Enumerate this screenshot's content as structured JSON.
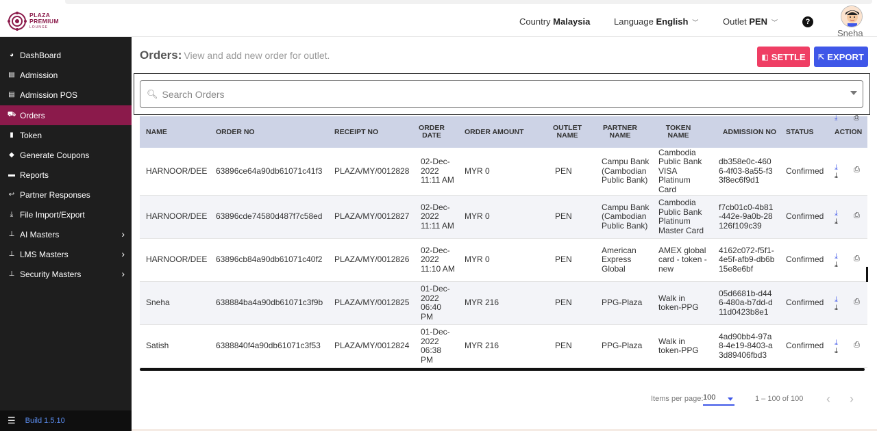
{
  "header": {
    "logo_line1": "PLAZA",
    "logo_line2": "PREMIUM",
    "logo_line3": "LOUNGE",
    "country_label": "Country",
    "country_value": "Malaysia",
    "language_label": "Language",
    "language_value": "English",
    "outlet_label": "Outlet",
    "outlet_value": "PEN",
    "help_glyph": "?",
    "user_name": "Sneha"
  },
  "sidebar": {
    "items": [
      {
        "label": "DashBoard",
        "icon": "dashboard-icon",
        "glyph": "◕"
      },
      {
        "label": "Admission",
        "icon": "id-card-icon",
        "glyph": "▤"
      },
      {
        "label": "Admission POS",
        "icon": "id-card-icon",
        "glyph": "▤"
      },
      {
        "label": "Orders",
        "icon": "cart-icon",
        "glyph": "🛒"
      },
      {
        "label": "Token",
        "icon": "document-icon",
        "glyph": "▮"
      },
      {
        "label": "Generate Coupons",
        "icon": "tag-icon",
        "glyph": "◆"
      },
      {
        "label": "Reports",
        "icon": "book-icon",
        "glyph": "▬"
      },
      {
        "label": "Partner Responses",
        "icon": "reply-icon",
        "glyph": "↩"
      },
      {
        "label": "File Import/Export",
        "icon": "download-icon",
        "glyph": "⤓"
      },
      {
        "label": "AI Masters",
        "icon": "sitemap-icon",
        "glyph": "⊥"
      },
      {
        "label": "LMS Masters",
        "icon": "sitemap-icon",
        "glyph": "⊥"
      },
      {
        "label": "Security Masters",
        "icon": "sitemap-icon",
        "glyph": "⊥"
      }
    ],
    "build": "Build 1.5.10"
  },
  "main": {
    "title": "Orders:",
    "subtitle": "View and add new order for outlet.",
    "settle_label": "SETTLE",
    "export_label": "EXPORT",
    "search_placeholder": "Search Orders"
  },
  "table": {
    "columns": [
      "NAME",
      "ORDER NO",
      "RECEIPT NO",
      "ORDER DATE",
      "ORDER AMOUNT",
      "OUTLET NAME",
      "PARTNER NAME",
      "TOKEN NAME",
      "ADMISSION NO",
      "STATUS",
      "ACTION"
    ],
    "rows": [
      {
        "name": "HARNOOR/DEE",
        "order_no": "63896ce64a90db61071c41f3",
        "receipt_no": "PLAZA/MY/0012828",
        "order_date": "02-Dec-2022 11:11 AM",
        "amount": "MYR 0",
        "outlet": "PEN",
        "partner": "Campu Bank (Cambodian Public Bank)",
        "token": "Cambodia Public Bank VISA Platinum Card",
        "admission_no": "db358e0c-4606-4f03-8a55-f33f8ec6f9d1",
        "status": "Confirmed"
      },
      {
        "name": "HARNOOR/DEE",
        "order_no": "63896cde74580d487f7c58ed",
        "receipt_no": "PLAZA/MY/0012827",
        "order_date": "02-Dec-2022 11:11 AM",
        "amount": "MYR 0",
        "outlet": "PEN",
        "partner": "Campu Bank (Cambodian Public Bank)",
        "token": "Cambodia Public Bank Platinum Master Card",
        "admission_no": "f7cb01c0-4b81-442e-9a0b-28126f109c39",
        "status": "Confirmed"
      },
      {
        "name": "HARNOOR/DEE",
        "order_no": "63896cb84a90db61071c40f2",
        "receipt_no": "PLAZA/MY/0012826",
        "order_date": "02-Dec-2022 11:10 AM",
        "amount": "MYR 0",
        "outlet": "PEN",
        "partner": "American Express Global",
        "token": "AMEX global card - token - new",
        "admission_no": "4162c072-f5f1-4e5f-afb9-db6b15e8e6bf",
        "status": "Confirmed"
      },
      {
        "name": "Sneha",
        "order_no": "638884ba4a90db61071c3f9b",
        "receipt_no": "PLAZA/MY/0012825",
        "order_date": "01-Dec-2022 06:40 PM",
        "amount": "MYR 216",
        "outlet": "PEN",
        "partner": "PPG-Plaza",
        "token": "Walk in token-PPG",
        "admission_no": "05d6681b-d446-480a-b7dd-d11d0423b8e1",
        "status": "Confirmed"
      },
      {
        "name": "Satish",
        "order_no": "6388840f4a90db61071c3f53",
        "receipt_no": "PLAZA/MY/0012824",
        "order_date": "01-Dec-2022 06:38 PM",
        "amount": "MYR 216",
        "outlet": "PEN",
        "partner": "PPG-Plaza",
        "token": "Walk in token-PPG",
        "admission_no": "4ad90bb4-97a8-4e19-8403-a3d89406fbd3",
        "status": "Confirmed"
      }
    ]
  },
  "pagination": {
    "items_per_page_label": "Items per page:",
    "items_per_page": "100",
    "range": "1 – 100 of 100",
    "prev_glyph": "‹",
    "next_glyph": "›"
  },
  "colors": {
    "brand": "#8b1a4b",
    "settle": "#ef3e64",
    "export": "#3f57e8",
    "table_header": "#cdd3e6",
    "sidebar": "#1e1e1e"
  }
}
